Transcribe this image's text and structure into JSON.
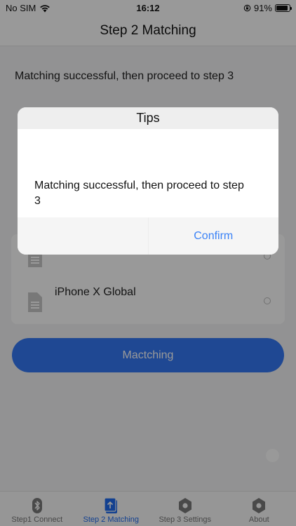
{
  "status_bar": {
    "carrier": "No SIM",
    "time": "16:12",
    "battery": "91%",
    "battery_level": 0.91
  },
  "nav": {
    "title": "Step 2 Matching"
  },
  "content": {
    "status_message": "Matching successful, then proceed to step 3",
    "devices": [
      {
        "label": ""
      },
      {
        "label": "iPhone X Global"
      }
    ],
    "match_button_label": "Mactching"
  },
  "dialog": {
    "title": "Tips",
    "message": "Matching successful, then proceed to step 3",
    "confirm_label": "Confirm"
  },
  "tabs": [
    {
      "label": "Step1 Connect",
      "icon": "bluetooth-icon",
      "active": false
    },
    {
      "label": "Step 2 Matching",
      "icon": "upload-icon",
      "active": true
    },
    {
      "label": "Step 3 Settings",
      "icon": "hexagon-gear-icon",
      "active": false
    },
    {
      "label": "About",
      "icon": "hexagon-gear-icon",
      "active": false
    }
  ],
  "colors": {
    "accent": "#3478f6",
    "tab_active": "#1f6cf0",
    "confirm_text": "#3b82f6"
  }
}
